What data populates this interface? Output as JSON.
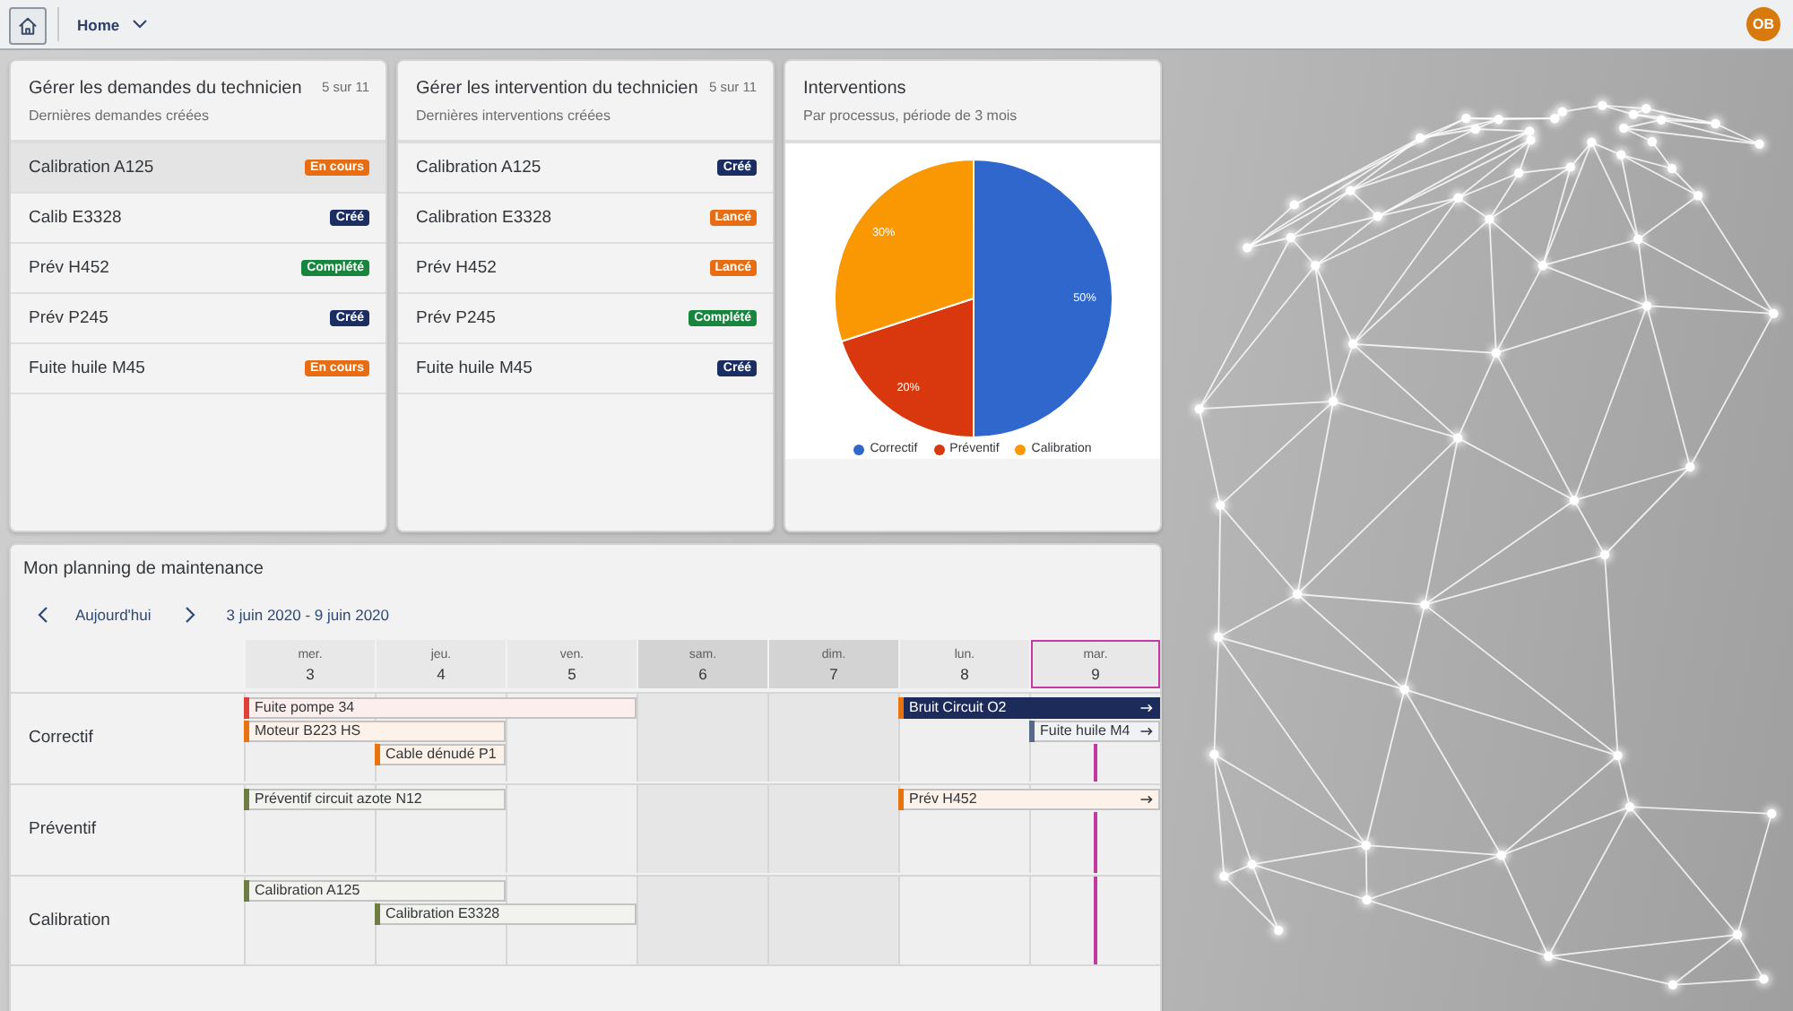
{
  "shell_bar": {
    "menu_title": "Home",
    "avatar_initials": "OB"
  },
  "cards": [
    {
      "kind": "list",
      "title": "Gérer les demandes du technicien",
      "count": "5 sur 11",
      "subtitle": "Dernières demandes créées",
      "items": [
        {
          "title": "Calibration A125",
          "status": "En cours",
          "color": "#e86d12",
          "selected": true
        },
        {
          "title": "Calib E3328",
          "status": "Créé",
          "color": "#1b2d63",
          "selected": false
        },
        {
          "title": "Prév H452",
          "status": "Complété",
          "color": "#17853d",
          "selected": false
        },
        {
          "title": "Prév P245",
          "status": "Créé",
          "color": "#1b2d63",
          "selected": false
        },
        {
          "title": "Fuite huile M45",
          "status": "En cours",
          "color": "#e86d12",
          "selected": false
        }
      ]
    },
    {
      "kind": "list",
      "title": "Gérer les intervention du technicien",
      "count": "5 sur 11",
      "subtitle": "Dernières interventions créées",
      "items": [
        {
          "title": "Calibration A125",
          "status": "Créé",
          "color": "#1b2d63",
          "selected": false
        },
        {
          "title": "Calibration E3328",
          "status": "Lancé",
          "color": "#e86d12",
          "selected": false
        },
        {
          "title": "Prév H452",
          "status": "Lancé",
          "color": "#e86d12",
          "selected": false
        },
        {
          "title": "Prév P245",
          "status": "Complété",
          "color": "#17853d",
          "selected": false
        },
        {
          "title": "Fuite huile M45",
          "status": "Créé",
          "color": "#1b2d63",
          "selected": false
        }
      ]
    },
    {
      "kind": "chart",
      "title": "Interventions",
      "subtitle": "Par processus, période de 3 mois",
      "chart_data": {
        "type": "pie",
        "categories": [
          "Correctif",
          "Préventif",
          "Calibration"
        ],
        "values": [
          50,
          20,
          30
        ],
        "colors": [
          "#2f67cc",
          "#d9380f",
          "#fa9804"
        ],
        "value_labels": [
          "50%",
          "20%",
          "30%"
        ],
        "legend": "bottom"
      }
    }
  ],
  "planning": {
    "title": "Mon planning de maintenance",
    "today_label": "Aujourd'hui",
    "date_range": "3 juin 2020 - 9 juin 2020",
    "days": [
      {
        "weekday": "mer.",
        "number": "3",
        "weekend": false,
        "today": false
      },
      {
        "weekday": "jeu.",
        "number": "4",
        "weekend": false,
        "today": false
      },
      {
        "weekday": "ven.",
        "number": "5",
        "weekend": false,
        "today": false
      },
      {
        "weekday": "sam.",
        "number": "6",
        "weekend": true,
        "today": false
      },
      {
        "weekday": "dim.",
        "number": "7",
        "weekend": true,
        "today": false
      },
      {
        "weekday": "lun.",
        "number": "8",
        "weekend": false,
        "today": false
      },
      {
        "weekday": "mar.",
        "number": "9",
        "weekend": false,
        "today": true
      }
    ],
    "rows": [
      {
        "label": "Correctif",
        "lanes": [
          [
            {
              "kind": "appointment",
              "title": "Fuite pompe 34",
              "color": "#e0403a",
              "selected": false,
              "continues": false
            },
            {
              "kind": "continued"
            },
            {
              "kind": "continued"
            },
            {
              "kind": "free"
            },
            {
              "kind": "free"
            },
            {
              "kind": "appointment",
              "title": "Bruit Circuit O2",
              "color": "#e9730c",
              "selected": true,
              "continues": true
            },
            {
              "kind": "continued"
            }
          ],
          [
            {
              "kind": "appointment",
              "title": "Moteur B223 HS",
              "color": "#e9730c",
              "selected": false,
              "continues": false
            },
            {
              "kind": "continued"
            },
            {
              "kind": "free"
            },
            {
              "kind": "free"
            },
            {
              "kind": "free"
            },
            {
              "kind": "free"
            },
            {
              "kind": "appointment",
              "title": "Fuite huile M4",
              "color": "#56698d",
              "selected": false,
              "continues": true
            }
          ],
          [
            {
              "kind": "free"
            },
            {
              "kind": "appointment",
              "title": "Cable dénudé P1",
              "color": "#e9730c",
              "selected": false,
              "continues": false
            },
            {
              "kind": "free"
            },
            {
              "kind": "free"
            },
            {
              "kind": "free"
            },
            {
              "kind": "free"
            },
            {
              "kind": "free"
            }
          ]
        ]
      },
      {
        "label": "Préventif",
        "lanes": [
          [
            {
              "kind": "appointment",
              "title": "Préventif circuit azote N12",
              "color": "#6f7d45",
              "selected": false,
              "continues": false
            },
            {
              "kind": "continued"
            },
            {
              "kind": "free"
            },
            {
              "kind": "free"
            },
            {
              "kind": "free"
            },
            {
              "kind": "appointment",
              "title": "Prév H452",
              "color": "#e9730c",
              "selected": false,
              "continues": true
            },
            {
              "kind": "continued"
            }
          ]
        ]
      },
      {
        "label": "Calibration",
        "lanes": [
          [
            {
              "kind": "appointment",
              "title": "Calibration A125",
              "color": "#6f7d45",
              "selected": false,
              "continues": false
            },
            {
              "kind": "continued"
            },
            {
              "kind": "free"
            },
            {
              "kind": "free"
            },
            {
              "kind": "free"
            },
            {
              "kind": "free"
            },
            {
              "kind": "free"
            }
          ],
          [
            {
              "kind": "free"
            },
            {
              "kind": "appointment",
              "title": "Calibration E3328",
              "color": "#6f7d45",
              "selected": false,
              "continues": false
            },
            {
              "kind": "continued"
            },
            {
              "kind": "free"
            },
            {
              "kind": "free"
            },
            {
              "kind": "free"
            },
            {
              "kind": "free"
            }
          ]
        ]
      }
    ]
  }
}
